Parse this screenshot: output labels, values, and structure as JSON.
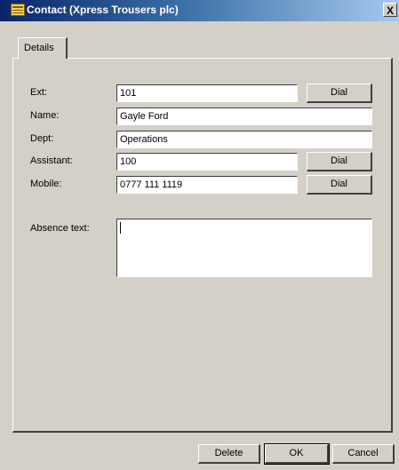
{
  "window": {
    "title": "Contact (Xpress Trousers plc)",
    "close_label": "X"
  },
  "tabs": [
    {
      "label": "Details"
    }
  ],
  "form": {
    "ext": {
      "label": "Ext:",
      "value": "101",
      "dial_label": "Dial"
    },
    "name": {
      "label": "Name:",
      "value": "Gayle Ford"
    },
    "dept": {
      "label": "Dept:",
      "value": "Operations"
    },
    "assistant": {
      "label": "Assistant:",
      "value": "100",
      "dial_label": "Dial"
    },
    "mobile": {
      "label": "Mobile:",
      "value": "0777 111 1119",
      "dial_label": "Dial"
    },
    "absence": {
      "label": "Absence text:",
      "value": ""
    }
  },
  "footer": {
    "delete_label": "Delete",
    "ok_label": "OK",
    "cancel_label": "Cancel"
  },
  "colors": {
    "face": "#d4d0c8",
    "title_start": "#0a246a",
    "title_end": "#a6caf0"
  }
}
